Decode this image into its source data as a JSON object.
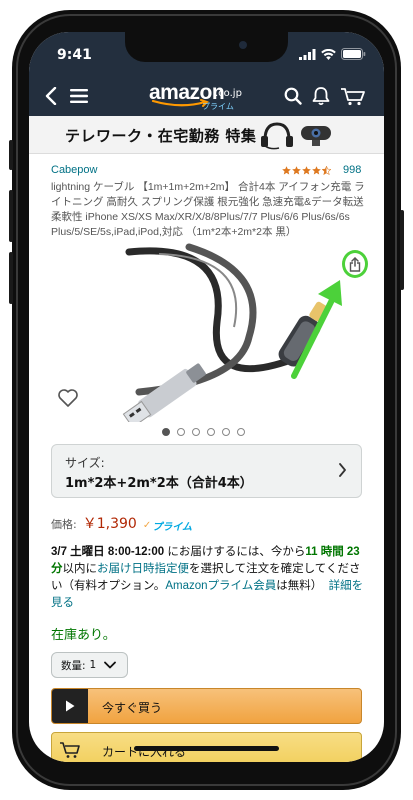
{
  "status_bar": {
    "time": "9:41"
  },
  "nav": {
    "back_icon": "chevron-left-icon",
    "menu_icon": "hamburger-menu-icon",
    "logo_text": "amazon",
    "logo_suffix": ".co.jp",
    "logo_prime": "プライム",
    "search_icon": "search-icon",
    "bell_icon": "bell-icon",
    "cart_icon": "cart-icon"
  },
  "banner": {
    "text": "テレワーク・在宅勤務 特集"
  },
  "product": {
    "brand": "Cabepow",
    "rating_stars": 4.5,
    "rating_count": "998",
    "title": "lightning ケーブル 【1m+1m+2m+2m】 合計4本 アイフォン充電 ライトニング 高耐久 スプリング保護 根元強化 急速充電&データ転送 柔軟性 iPhone XS/XS Max/XR/X/8/8Plus/7/7 Plus/6/6 Plus/6s/6s Plus/5/SE/5s,iPad,iPod,対応 （1m*2本+2m*2本 黒）",
    "image_count": 6,
    "active_image": 0
  },
  "size": {
    "label": "サイズ:",
    "value": "1m*2本+2m*2本（合計4本）"
  },
  "price": {
    "label": "価格:",
    "value": "￥1,390",
    "prime_label": "プライム"
  },
  "delivery": {
    "date": "3/7 土曜日 8:00-12:00",
    "text1": " にお届けするには、今から",
    "countdown1": "11 時間 23 分",
    "text2": "以内に",
    "link1": "お届け日時指定便",
    "text3": "を選択して注文を確定してください（有料オプション。",
    "link2": "Amazonプライム会員",
    "text4": "は無料）",
    "link3": "詳細を見る"
  },
  "stock": {
    "text": "在庫あり。"
  },
  "quantity": {
    "label": "数量:",
    "value": "1"
  },
  "buttons": {
    "buy_now": "今すぐ買う",
    "add_to_cart": "カートに入れる"
  },
  "colors": {
    "nav_bg": "#232f3e",
    "link": "#007185",
    "price": "#b12704",
    "in_stock": "#007600",
    "buy_now": "#f1a340",
    "cart": "#f1cf5b",
    "highlight": "#4cd13a"
  }
}
